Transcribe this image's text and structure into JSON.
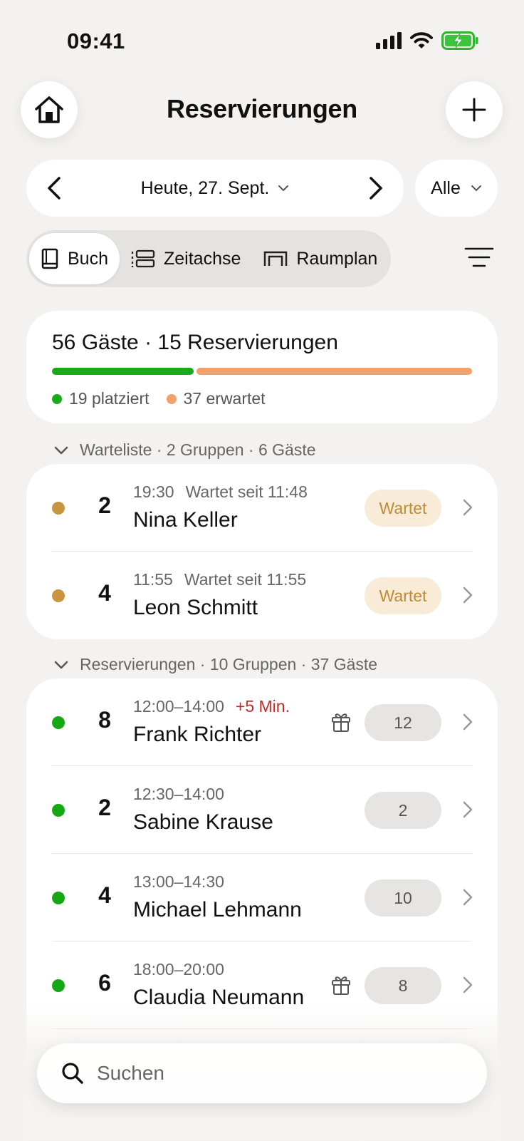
{
  "status_bar": {
    "time": "09:41"
  },
  "header": {
    "title": "Reservierungen"
  },
  "date_nav": {
    "date_label": "Heute, 27. Sept.",
    "filter_label": "Alle"
  },
  "view_tabs": [
    {
      "label": "Buch",
      "icon": "book-icon",
      "active": true
    },
    {
      "label": "Zeitachse",
      "icon": "timeline-icon",
      "active": false
    },
    {
      "label": "Raumplan",
      "icon": "floorplan-icon",
      "active": false
    }
  ],
  "summary": {
    "title": "56 Gäste · 15 Reservierungen",
    "placed_label": "19 platziert",
    "expected_label": "37 erwartet",
    "placed_fraction": 0.34,
    "placed_color": "#1aaa1a",
    "expected_color": "#f0a26a"
  },
  "waitlist": {
    "header": "Warteliste · 2 Gruppen · 6 Gäste",
    "rows": [
      {
        "party": "2",
        "time": "19:30",
        "extra": "Wartet seit 11:48",
        "name": "Nina Keller",
        "badge": "Wartet"
      },
      {
        "party": "4",
        "time": "11:55",
        "extra": "Wartet seit 11:55",
        "name": "Leon Schmitt",
        "badge": "Wartet"
      }
    ]
  },
  "reservations": {
    "header": "Reservierungen · 10 Gruppen · 37 Gäste",
    "rows": [
      {
        "party": "8",
        "time": "12:00–14:00",
        "late": "+5 Min.",
        "name": "Frank Richter",
        "gift": true,
        "table": "12"
      },
      {
        "party": "2",
        "time": "12:30–14:00",
        "late": "",
        "name": "Sabine Krause",
        "gift": false,
        "table": "2"
      },
      {
        "party": "4",
        "time": "13:00–14:30",
        "late": "",
        "name": "Michael Lehmann",
        "gift": false,
        "table": "10"
      },
      {
        "party": "6",
        "time": "18:00–20:00",
        "late": "",
        "name": "Claudia Neumann",
        "gift": true,
        "table": "8"
      }
    ]
  },
  "search": {
    "placeholder": "Suchen"
  },
  "colors": {
    "waitlist_dot": "#c9953f",
    "seated_dot": "#14a814",
    "late_text": "#c42b2b"
  }
}
